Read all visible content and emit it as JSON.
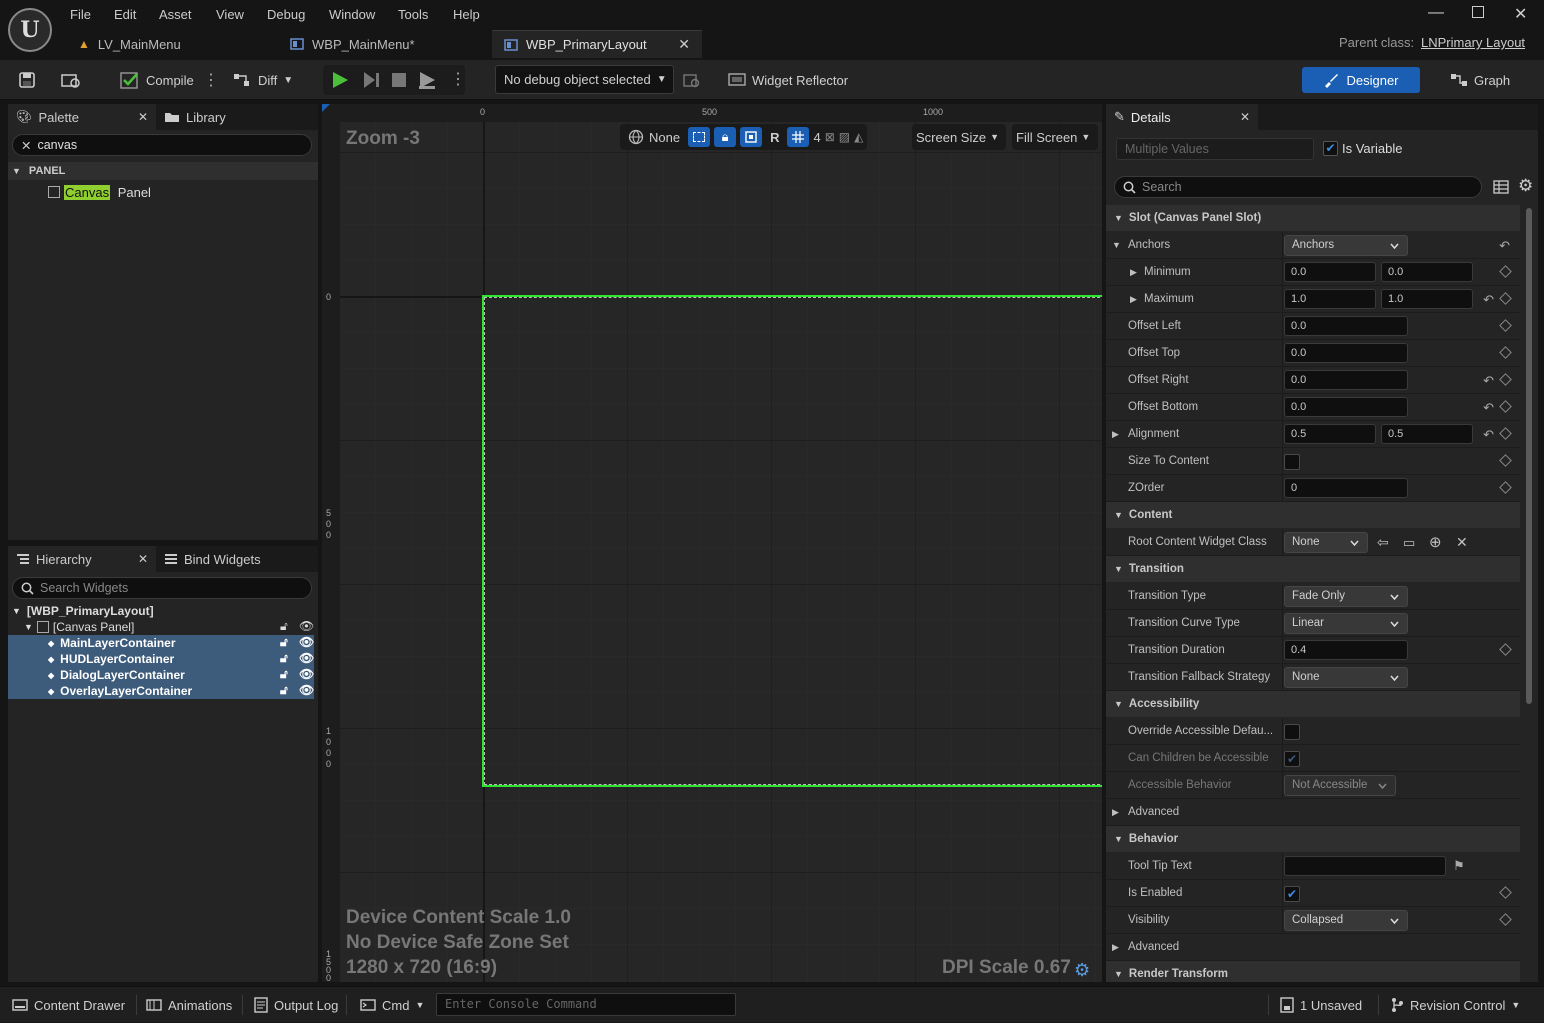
{
  "app": {
    "logo": "U"
  },
  "menu": [
    "File",
    "Edit",
    "Asset",
    "View",
    "Debug",
    "Window",
    "Tools",
    "Help"
  ],
  "tabs": [
    {
      "label": "LV_MainMenu",
      "icon": "level-icon"
    },
    {
      "label": "WBP_MainMenu*",
      "icon": "widget-blueprint-icon"
    },
    {
      "label": "WBP_PrimaryLayout",
      "icon": "widget-blueprint-icon"
    }
  ],
  "parent_class": {
    "label": "Parent class:",
    "value": "LNPrimary Layout"
  },
  "toolbar": {
    "compile": "Compile",
    "diff": "Diff",
    "debug_object": "No debug object selected",
    "widget_reflector": "Widget Reflector",
    "designer": "Designer",
    "graph": "Graph"
  },
  "palette": {
    "tab": "Palette",
    "library_tab": "Library",
    "search_value": "canvas",
    "category": "PANEL",
    "item_match": "Canvas",
    "item_rest": " Panel"
  },
  "hierarchy": {
    "tab": "Hierarchy",
    "bind_tab": "Bind Widgets",
    "search_placeholder": "Search Widgets",
    "root": "[WBP_PrimaryLayout]",
    "canvas": "[Canvas Panel]",
    "children": [
      "MainLayerContainer",
      "HUDLayerContainer",
      "DialogLayerContainer",
      "OverlayLayerContainer"
    ]
  },
  "viewport": {
    "zoom": "Zoom -3",
    "none_label": "None",
    "r_label": "R",
    "grid_count": "4",
    "screen_size": "Screen Size",
    "fill_screen": "Fill Screen",
    "ruler_h": [
      "0",
      "500",
      "1000"
    ],
    "ruler_v": [
      "0",
      "500",
      "1000",
      "1500"
    ],
    "device_scale": "Device Content Scale 1.0",
    "safe_zone": "No Device Safe Zone Set",
    "resolution": "1280 x 720 (16:9)",
    "dpi": "DPI Scale 0.67"
  },
  "details": {
    "tab": "Details",
    "name_placeholder": "Multiple Values",
    "is_variable": "Is Variable",
    "search_placeholder": "Search",
    "slot_section": "Slot (Canvas Panel Slot)",
    "anchors": {
      "label": "Anchors",
      "value": "Anchors"
    },
    "minimum": {
      "label": "Minimum",
      "x": "0.0",
      "y": "0.0"
    },
    "maximum": {
      "label": "Maximum",
      "x": "1.0",
      "y": "1.0"
    },
    "offset_left": {
      "label": "Offset Left",
      "value": "0.0"
    },
    "offset_top": {
      "label": "Offset Top",
      "value": "0.0"
    },
    "offset_right": {
      "label": "Offset Right",
      "value": "0.0"
    },
    "offset_bottom": {
      "label": "Offset Bottom",
      "value": "0.0"
    },
    "alignment": {
      "label": "Alignment",
      "x": "0.5",
      "y": "0.5"
    },
    "size_to_content": {
      "label": "Size To Content"
    },
    "zorder": {
      "label": "ZOrder",
      "value": "0"
    },
    "content_section": "Content",
    "root_content": {
      "label": "Root Content Widget Class",
      "value": "None"
    },
    "transition_section": "Transition",
    "transition_type": {
      "label": "Transition Type",
      "value": "Fade Only"
    },
    "transition_curve": {
      "label": "Transition Curve Type",
      "value": "Linear"
    },
    "transition_duration": {
      "label": "Transition Duration",
      "value": "0.4"
    },
    "transition_fallback": {
      "label": "Transition Fallback Strategy",
      "value": "None"
    },
    "accessibility_section": "Accessibility",
    "override_accessible": {
      "label": "Override Accessible Defau..."
    },
    "children_accessible": {
      "label": "Can Children be Accessible"
    },
    "accessible_behavior": {
      "label": "Accessible Behavior",
      "value": "Not Accessible"
    },
    "advanced": "Advanced",
    "behavior_section": "Behavior",
    "tooltip": {
      "label": "Tool Tip Text",
      "value": ""
    },
    "is_enabled": {
      "label": "Is Enabled"
    },
    "visibility": {
      "label": "Visibility",
      "value": "Collapsed"
    },
    "advanced2": "Advanced",
    "render_section": "Render Transform"
  },
  "statusbar": {
    "content_drawer": "Content Drawer",
    "animations": "Animations",
    "output_log": "Output Log",
    "cmd": "Cmd",
    "console_placeholder": "Enter Console Command",
    "unsaved": "1 Unsaved",
    "revision": "Revision Control"
  },
  "colors": {
    "accent": "#1a5fb4",
    "selection": "#3d5b7a",
    "canvas_outline": "#2ee62e",
    "play": "#4bbf3a"
  }
}
